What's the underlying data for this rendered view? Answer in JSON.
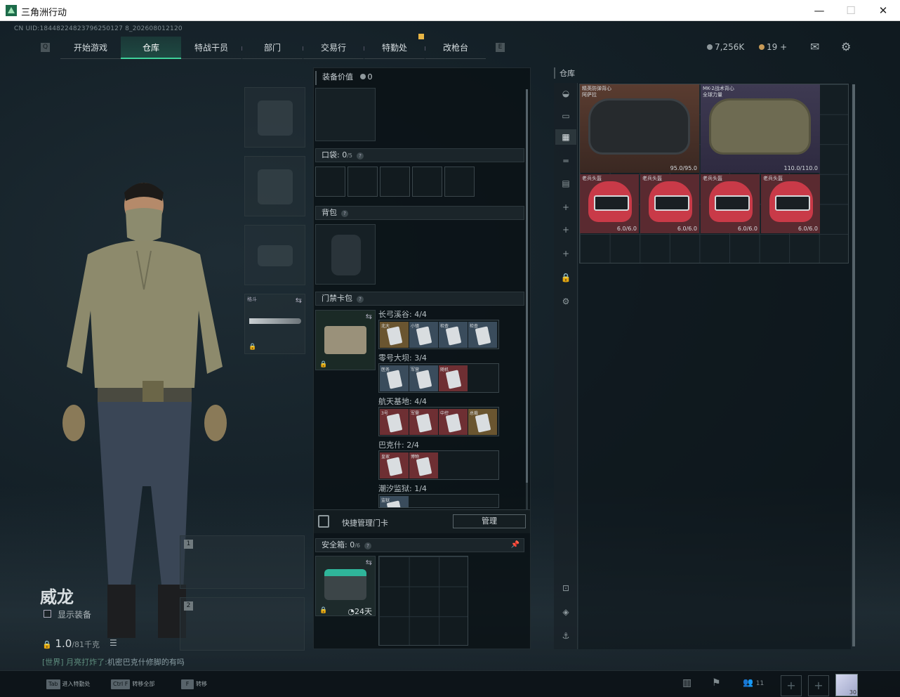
{
  "window": {
    "title": "三角洲行动",
    "minimize": "—",
    "maximize": "☐",
    "close": "✕"
  },
  "uid": "CN UID:18448224823796250127 8_202608012120",
  "nav": {
    "left_key": "Q",
    "right_key": "E",
    "tabs": [
      {
        "label": "开始游戏",
        "active": false
      },
      {
        "label": "仓库",
        "active": true
      },
      {
        "label": "特战干员",
        "active": false
      },
      {
        "label": "部门",
        "active": false
      },
      {
        "label": "交易行",
        "active": false
      },
      {
        "label": "特勤处",
        "active": false,
        "badge": true
      },
      {
        "label": "改枪台",
        "active": false
      }
    ]
  },
  "currency": {
    "silver": "7,256K",
    "bonds": "19",
    "add": "+"
  },
  "top_icons": {
    "mail": "✉",
    "settings": "⚙"
  },
  "character": {
    "name": "威龙",
    "show_gear_label": "显示装备",
    "weight_value": "1.0",
    "weight_max": "/81千克"
  },
  "chat": {
    "channel": "[世界]",
    "user": "月亮打炸了:",
    "message": "机密巴克什修脚的有吗"
  },
  "melee": {
    "label": "格斗"
  },
  "weapon_slots": [
    "1",
    "2"
  ],
  "mid": {
    "value_label": "装备价值",
    "value": "0",
    "pocket_label": "口袋:",
    "pocket_count": "0",
    "pocket_max": "/5",
    "backpack_label": "背包",
    "keycard_label": "门禁卡包",
    "maps": [
      {
        "name": "长弓溪谷: 4/4",
        "cards": [
          {
            "label": "北大",
            "color": "gold"
          },
          {
            "label": "小镇",
            "color": "blue"
          },
          {
            "label": "检查",
            "color": "blue"
          },
          {
            "label": "检查",
            "color": "blue"
          }
        ]
      },
      {
        "name": "零号大坝: 3/4",
        "cards": [
          {
            "label": "医务",
            "color": "blue"
          },
          {
            "label": "军营",
            "color": "blue"
          },
          {
            "label": "随机",
            "color": "red"
          }
        ]
      },
      {
        "name": "航天基地: 4/4",
        "cards": [
          {
            "label": "3号",
            "color": "red"
          },
          {
            "label": "军需",
            "color": "red"
          },
          {
            "label": "中控",
            "color": "red"
          },
          {
            "label": "总裁",
            "color": "gold"
          }
        ]
      },
      {
        "name": "巴克什: 2/4",
        "cards": [
          {
            "label": "皇家",
            "color": "red"
          },
          {
            "label": "博物",
            "color": "red"
          }
        ]
      },
      {
        "name": "潮汐监狱: 1/4",
        "cards": [
          {
            "label": "监狱",
            "color": "blue"
          }
        ]
      }
    ],
    "quick_manage_label": "快捷管理门卡",
    "manage_button": "管理",
    "safebox_label": "安全箱:",
    "safebox_count": "0",
    "safebox_max": "/6",
    "safebox_time": "24天"
  },
  "stash": {
    "title": "仓库",
    "items": [
      {
        "name": "精英防弹背心",
        "sub": "阿萨拉",
        "durability": "95.0/95.0"
      },
      {
        "name": "MK-2战术背心",
        "sub": "全球力量",
        "durability": "110.0/110.0"
      },
      {
        "name": "老兵头盔",
        "durability": "6.0/6.0"
      },
      {
        "name": "老兵头盔",
        "durability": "6.0/6.0"
      },
      {
        "name": "老兵头盔",
        "durability": "6.0/6.0"
      },
      {
        "name": "老兵头盔",
        "durability": "6.0/6.0"
      }
    ]
  },
  "bottom": {
    "hints": [
      {
        "key": "Tab",
        "label": "进入特勤处"
      },
      {
        "key": "Ctrl F",
        "label": "转移全部"
      },
      {
        "key": "F",
        "label": "转移"
      }
    ],
    "friends_count": "11",
    "avatar_level": "30"
  }
}
